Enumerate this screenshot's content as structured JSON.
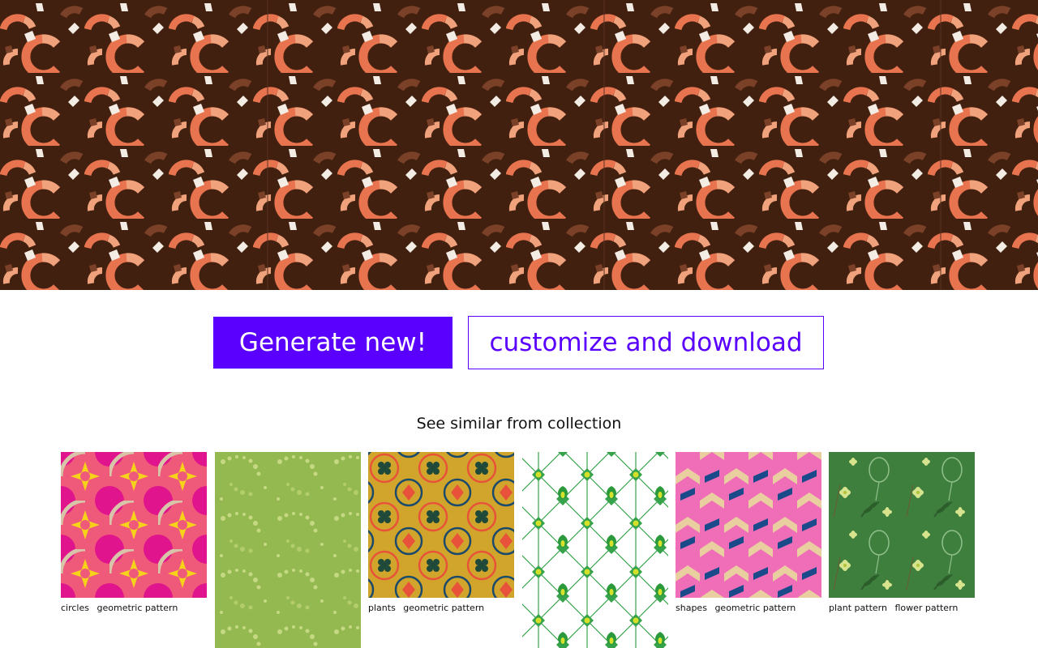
{
  "actions": {
    "generate_label": "Generate new!",
    "customize_label": "customize and download"
  },
  "similar": {
    "title": "See similar from collection",
    "items": [
      {
        "tags": [
          "circles",
          "geometric pattern"
        ]
      },
      {
        "tags": []
      },
      {
        "tags": [
          "plants",
          "geometric pattern"
        ]
      },
      {
        "tags": []
      },
      {
        "tags": [
          "shapes",
          "geometric pattern"
        ]
      },
      {
        "tags": [
          "plant pattern",
          "flower pattern"
        ]
      }
    ]
  },
  "colors": {
    "accent": "#5a00ff",
    "hero_background": "#42200f",
    "hero_coral": "#e8744f",
    "hero_peach": "#f0a27c",
    "hero_brown": "#7a4128",
    "hero_white": "#f3ece4"
  }
}
